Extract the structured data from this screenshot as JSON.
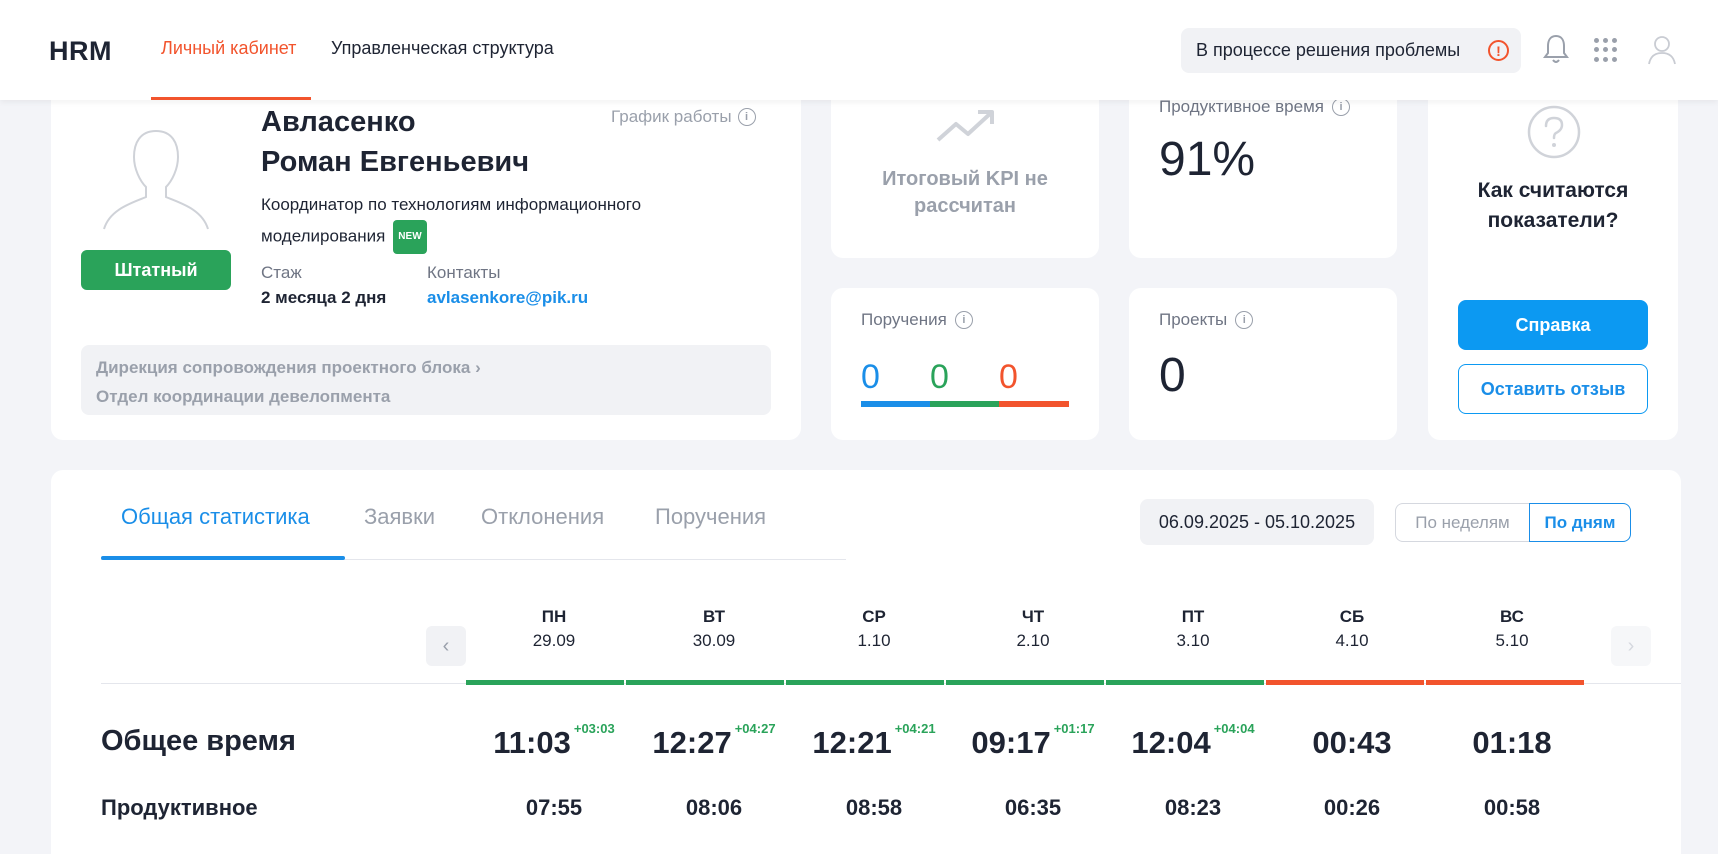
{
  "header": {
    "logo": "HRM",
    "nav": [
      {
        "label": "Личный кабинет"
      },
      {
        "label": "Управленческая структура"
      }
    ],
    "status": "В процессе решения проблемы",
    "status_icon": "!"
  },
  "profile": {
    "name_line1": "Авласенко",
    "name_line2": "Роман Евгеньевич",
    "schedule_label": "График работы",
    "position": "Координатор по технологиям информационного моделирования",
    "new_badge": "NEW",
    "status_badge": "Штатный",
    "tenure_label": "Стаж",
    "tenure_value": "2 месяца 2 дня",
    "contacts_label": "Контакты",
    "email": "avlasenkore@pik.ru",
    "dept_line1": "Дирекция сопровождения проектного блока",
    "dept_chevron": "›",
    "dept_line2": "Отдел координации девелопмента"
  },
  "kpi": {
    "text_line1": "Итоговый KPI не",
    "text_line2": "рассчитан"
  },
  "productive": {
    "label": "Продуктивное время",
    "value": "91%"
  },
  "tasks": {
    "label": "Поручения",
    "counts": [
      "0",
      "0",
      "0"
    ],
    "colors": [
      "#1a8ee8",
      "#2aa35a",
      "#f2542d"
    ]
  },
  "projects": {
    "label": "Проекты",
    "value": "0"
  },
  "help": {
    "title_line1": "Как считаются",
    "title_line2": "показатели?",
    "primary_btn": "Справка",
    "secondary_btn": "Оставить отзыв"
  },
  "stats": {
    "tabs": [
      "Общая статистика",
      "Заявки",
      "Отклонения",
      "Поручения"
    ],
    "date_range": "06.09.2025 - 05.10.2025",
    "toggle": [
      "По неделям",
      "По дням"
    ],
    "prev_arrow": "‹",
    "next_arrow": "›",
    "days": [
      {
        "name": "ПН",
        "date": "29.09",
        "status": "green"
      },
      {
        "name": "ВТ",
        "date": "30.09",
        "status": "green"
      },
      {
        "name": "СР",
        "date": "1.10",
        "status": "green"
      },
      {
        "name": "ЧТ",
        "date": "2.10",
        "status": "green"
      },
      {
        "name": "ПТ",
        "date": "3.10",
        "status": "green"
      },
      {
        "name": "СБ",
        "date": "4.10",
        "status": "red"
      },
      {
        "name": "ВС",
        "date": "5.10",
        "status": "red"
      }
    ],
    "status_colors": {
      "green": "#2aa35a",
      "red": "#f2542d"
    },
    "rows": [
      {
        "label": "Общее время",
        "values": [
          "11:03",
          "12:27",
          "12:21",
          "09:17",
          "12:04",
          "00:43",
          "01:18"
        ],
        "deltas": [
          "+03:03",
          "+04:27",
          "+04:21",
          "+01:17",
          "+04:04",
          "",
          ""
        ]
      },
      {
        "label": "Продуктивное",
        "values": [
          "07:55",
          "08:06",
          "08:58",
          "06:35",
          "08:23",
          "00:26",
          "00:58"
        ]
      }
    ]
  }
}
